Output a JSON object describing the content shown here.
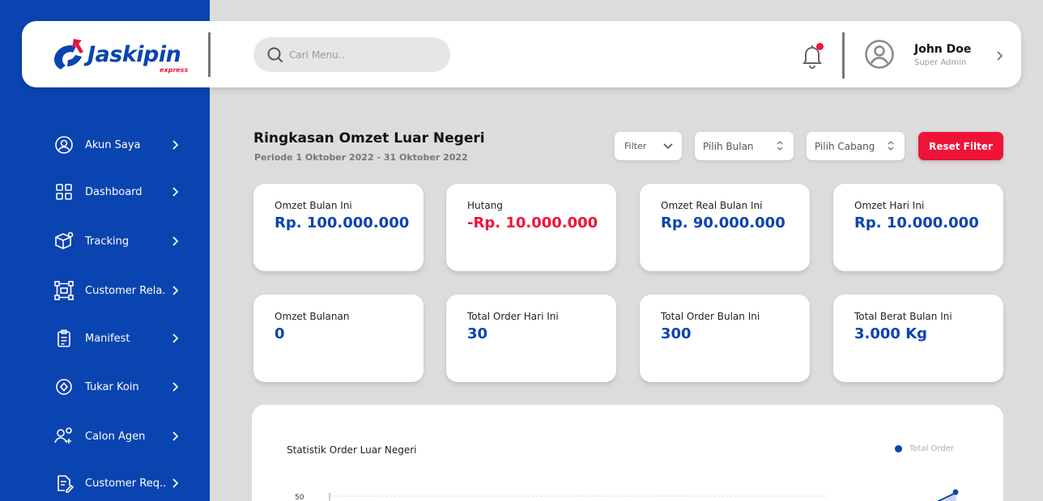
{
  "brand": {
    "name": "Jaskipin",
    "tagline": "express"
  },
  "search": {
    "placeholder": "Cari Menu.."
  },
  "user": {
    "name": "John Doe",
    "role": "Super Admin"
  },
  "sidebar": {
    "items": [
      {
        "label": "Akun Saya",
        "icon": "user-circle-icon"
      },
      {
        "label": "Dashboard",
        "icon": "grid-icon"
      },
      {
        "label": "Tracking",
        "icon": "package-location-icon"
      },
      {
        "label": "Customer Rela..",
        "icon": "network-icon"
      },
      {
        "label": "Manifest",
        "icon": "clipboard-icon"
      },
      {
        "label": "Tukar Koin",
        "icon": "coin-icon"
      },
      {
        "label": "Calon Agen",
        "icon": "user-add-icon"
      },
      {
        "label": "Customer Req..",
        "icon": "document-edit-icon"
      }
    ]
  },
  "summary": {
    "title": "Ringkasan Omzet Luar Negeri",
    "period": "Periode 1 Oktober 2022 - 31 Oktober 2022"
  },
  "filters": {
    "filter_label": "Filter",
    "month_label": "Pilih Bulan",
    "branch_label": "Pilih Cabang",
    "reset_label": "Reset Filter"
  },
  "cards": [
    {
      "label": "Omzet Bulan Ini",
      "value": "Rp. 100.000.000",
      "color": "#0a44b0"
    },
    {
      "label": "Hutang",
      "value": "-Rp. 10.000.000",
      "color": "#ee1438"
    },
    {
      "label": "Omzet Real Bulan Ini",
      "value": "Rp. 90.000.000",
      "color": "#0a44b0"
    },
    {
      "label": "Omzet Hari Ini",
      "value": "Rp. 10.000.000",
      "color": "#0a44b0"
    },
    {
      "label": "Omzet Bulanan",
      "value": "0",
      "color": "#0a44b0"
    },
    {
      "label": "Total Order Hari Ini",
      "value": "30",
      "color": "#0a44b0"
    },
    {
      "label": "Total Order Bulan Ini",
      "value": "300",
      "color": "#0a44b0"
    },
    {
      "label": "Total Berat Bulan Ini",
      "value": "3.000 Kg",
      "color": "#0a44b0"
    }
  ],
  "chart": {
    "title": "Statistik Order Luar Negeri",
    "legend": "Total Order",
    "y_tick_top": "50",
    "accent": "#0a44b0"
  },
  "colors": {
    "primary": "#0a44b0",
    "danger": "#ee1438",
    "background": "#dcdcdc"
  }
}
